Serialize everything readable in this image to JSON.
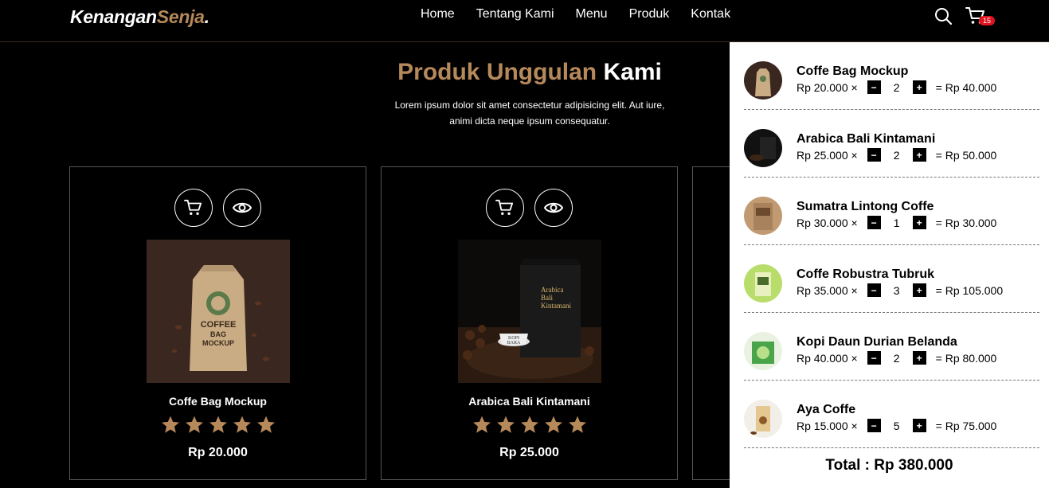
{
  "brand": {
    "name_main": "Kenangan",
    "name_accent": "Senja",
    "dot": "."
  },
  "nav": {
    "links": [
      "Home",
      "Tentang Kami",
      "Menu",
      "Produk",
      "Kontak"
    ],
    "cart_count": "15"
  },
  "hero": {
    "title_accent": "Produk Unggulan",
    "title_rest": "Kami",
    "subtitle": "Lorem ipsum dolor sit amet consectetur adipisicing elit. Aut iure, animi dicta neque ipsum consequatur."
  },
  "products": [
    {
      "name": "Coffe Bag Mockup",
      "price": "Rp 20.000",
      "rating": 5,
      "image_text": [
        "COFFEE",
        "BAG",
        "MOCKUP"
      ]
    },
    {
      "name": "Arabica Bali Kintamani",
      "price": "Rp 25.000",
      "rating": 5,
      "image_text": [
        "Arabica",
        "Bali",
        "Kintamani",
        "KOPI",
        "BARA"
      ]
    }
  ],
  "cart": {
    "items": [
      {
        "name": "Coffe Bag Mockup",
        "price": "Rp 20.000 ×",
        "qty": "2",
        "subtotal": "= Rp 40.000"
      },
      {
        "name": "Arabica Bali Kintamani",
        "price": "Rp 25.000 ×",
        "qty": "2",
        "subtotal": "= Rp 50.000"
      },
      {
        "name": "Sumatra Lintong Coffe",
        "price": "Rp 30.000 ×",
        "qty": "1",
        "subtotal": "= Rp 30.000"
      },
      {
        "name": "Coffe Robustra Tubruk",
        "price": "Rp 35.000 ×",
        "qty": "3",
        "subtotal": "= Rp 105.000"
      },
      {
        "name": "Kopi Daun Durian Belanda",
        "price": "Rp 40.000 ×",
        "qty": "2",
        "subtotal": "= Rp 80.000"
      },
      {
        "name": "Aya Coffe",
        "price": "Rp 15.000 ×",
        "qty": "5",
        "subtotal": "= Rp 75.000"
      }
    ],
    "minus_label": "−",
    "plus_label": "+",
    "total": "Total : Rp 380.000"
  },
  "colors": {
    "accent": "#b6895b",
    "badge": "#e0141e",
    "background": "#000000"
  },
  "icons": [
    "search-icon",
    "cart-icon",
    "eye-icon",
    "star-icon"
  ]
}
